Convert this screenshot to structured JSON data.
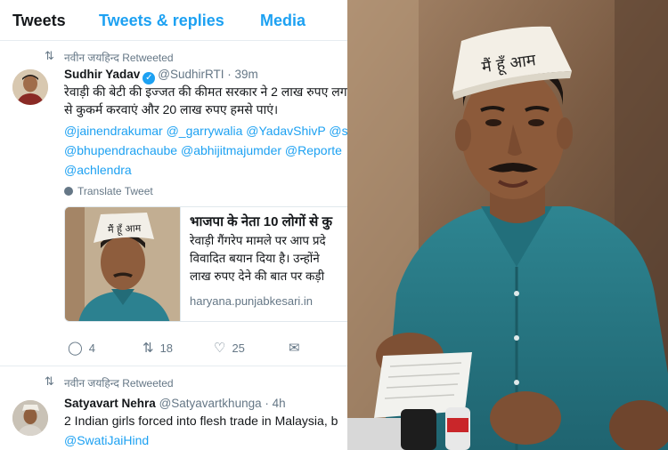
{
  "tabs": [
    "Tweets",
    "Tweets & replies",
    "Media"
  ],
  "tweets": [
    {
      "retweeted_by": "नवीन जयहिन्द Retweeted",
      "name": "Sudhir Yadav",
      "verified": true,
      "handle": "@SudhirRTI",
      "time": "· 39m",
      "text_lines": [
        "रेवाड़ी की बेटी की इज्जत की कीमत सरकार ने 2 लाख रुपए लगाई",
        "से कुकर्म करवाएं और 20 लाख रुपए हमसे पाएं।"
      ],
      "mention_lines": [
        "@jainendrakumar @_garrywalia @YadavShivP @sh",
        "@bhupendrachaube @abhijitmajumder @Reporte",
        "@achlendra"
      ],
      "translate": "Translate Tweet",
      "card": {
        "title": "भाजपा के नेता 10 लोगों से कु",
        "desc_lines": [
          "रेवाड़ी गैंगरेप मामले पर आप प्रदे",
          "विवादित बयान दिया है। उन्होंने",
          "लाख रुपए देने की बात पर कड़ी"
        ],
        "domain": "haryana.punjabkesari.in",
        "image_cap_text": "मैं हूँ आम"
      },
      "replies": "4",
      "retweets": "18",
      "likes": "25"
    },
    {
      "retweeted_by": "नवीन जयहिन्द Retweeted",
      "name": "Satyavart Nehra",
      "handle": "@Satyavartkhunga",
      "time": "· 4h",
      "text_lines": [
        "2 Indian girls forced into flesh trade in Malaysia, b"
      ],
      "mention_lines": [
        "@SwatiJaiHind"
      ]
    }
  ],
  "photo": {
    "cap_text": "मैं हूँ आम",
    "colors": {
      "cap": "#f3efe6",
      "shirt": "#2b7d89",
      "skin": "#8a5a3b",
      "background": "#7c5d44"
    }
  },
  "icons": {
    "retweet": "retweet-icon",
    "reply": "reply-icon",
    "like": "heart-icon",
    "dm": "envelope-icon",
    "globe": "globe-icon",
    "verified": "verified-badge-icon"
  },
  "colors": {
    "accent": "#1da1f2",
    "text": "#14171a",
    "muted": "#657786",
    "border": "#e6ecf0"
  }
}
